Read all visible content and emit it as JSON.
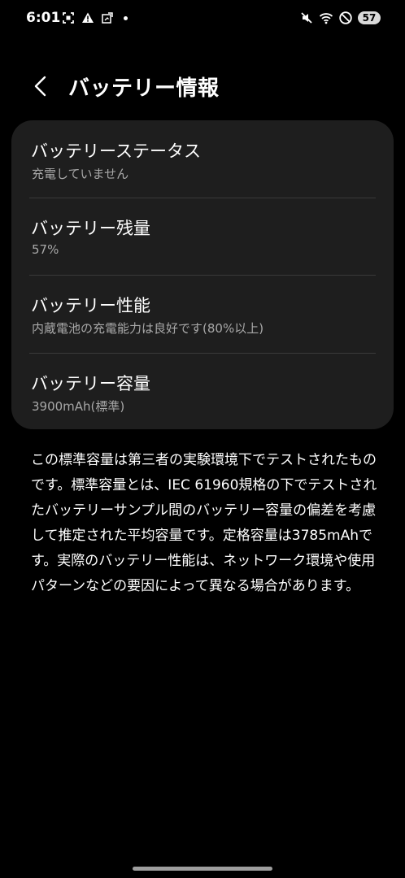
{
  "status_bar": {
    "time": "6:01",
    "left_icons": [
      "screenshot-icon",
      "warning-icon",
      "notification-icon"
    ],
    "right_icons": [
      "mute-icon",
      "wifi-icon",
      "do-not-disturb-icon"
    ],
    "battery_level": "57"
  },
  "header": {
    "title": "バッテリー情報"
  },
  "items": [
    {
      "title": "バッテリーステータス",
      "subtitle": "充電していません"
    },
    {
      "title": "バッテリー残量",
      "subtitle": "57%"
    },
    {
      "title": "バッテリー性能",
      "subtitle": "内蔵電池の充電能力は良好です(80%以上)"
    },
    {
      "title": "バッテリー容量",
      "subtitle": "3900mAh(標準)"
    }
  ],
  "description": "この標準容量は第三者の実験環境下でテストされたものです。標準容量とは、IEC 61960規格の下でテストされたバッテリーサンプル間のバッテリー容量の偏差を考慮して推定された平均容量です。定格容量は3785mAhです。実際のバッテリー性能は、ネットワーク環境や使用パターンなどの要因によって異なる場合があります。",
  "colors": {
    "background": "#000000",
    "card": "#1e1e1e",
    "secondary_text": "#a8a8a8"
  }
}
